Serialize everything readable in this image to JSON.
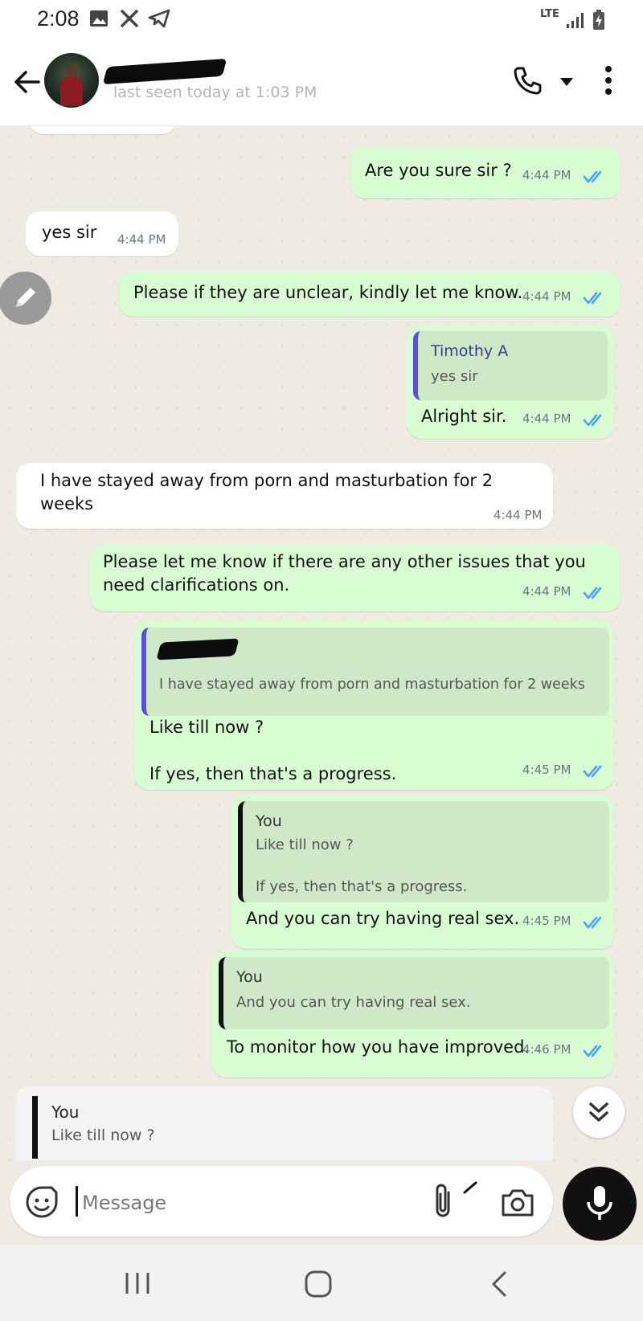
{
  "status_bar": {
    "time": "2:08",
    "network_label": "LTE",
    "icons": [
      "gallery-icon",
      "x-app-icon",
      "telegram-icon",
      "lte-icon",
      "signal-icon",
      "battery-charging-icon"
    ]
  },
  "header": {
    "contact_name": "",
    "last_seen": "last seen today at 1:03 PM",
    "icons": [
      "back-arrow-icon",
      "phone-icon",
      "dropdown-caret-icon",
      "more-vert-icon"
    ]
  },
  "messages": [
    {
      "id": "m1",
      "side": "out",
      "text": "Are you sure sir ?",
      "time": "4:44 PM",
      "read": true
    },
    {
      "id": "m2",
      "side": "in",
      "text": "yes sir",
      "time": "4:44 PM"
    },
    {
      "id": "m3",
      "side": "out",
      "text": "Please if they are unclear, kindly let me know.",
      "time": "4:44 PM",
      "read": true
    },
    {
      "id": "m4",
      "side": "out",
      "quote_name": "Timothy A",
      "quote_text": "yes sir",
      "text": "Alright sir.",
      "time": "4:44 PM",
      "read": true
    },
    {
      "id": "m5",
      "side": "in",
      "text": "I have stayed away from porn and masturbation for 2\nweeks",
      "time": "4:44 PM"
    },
    {
      "id": "m6",
      "side": "out",
      "text": "Please let me know if there are any other issues that you\nneed clarifications on.",
      "time": "4:44 PM",
      "read": true
    },
    {
      "id": "m7",
      "side": "out",
      "quote_name": "",
      "quote_text": "I have stayed away from porn and masturbation for 2 weeks",
      "text": "Like till now ?\n\nIf yes, then that's a progress.",
      "time": "4:45 PM",
      "read": true
    },
    {
      "id": "m8",
      "side": "out",
      "quote_name": "You",
      "quote_text": "Like till now ?\n\nIf yes, then that's a progress.",
      "text": "And you can try having real sex.",
      "time": "4:45 PM",
      "read": true
    },
    {
      "id": "m9",
      "side": "out",
      "quote_name": "You",
      "quote_text": "And you can try having real sex.",
      "text": "To monitor how you have improved.",
      "time": "4:46 PM",
      "read": true
    }
  ],
  "reply_preview": {
    "name": "You",
    "text": "Like till now ?"
  },
  "composer": {
    "placeholder": "Message",
    "icons": [
      "emoji-sticker-icon",
      "attach-icon",
      "camera-icon",
      "mic-icon"
    ]
  },
  "nav_bar": {
    "icons": [
      "recent-apps-icon",
      "home-icon",
      "back-icon"
    ]
  },
  "colors": {
    "outgoing_bubble": "#d9fdd3",
    "incoming_bubble": "#ffffff",
    "read_ticks": "#4fa3f7",
    "quote_bar_contact": "#5f4fd6",
    "chat_background": "#efeae2"
  }
}
